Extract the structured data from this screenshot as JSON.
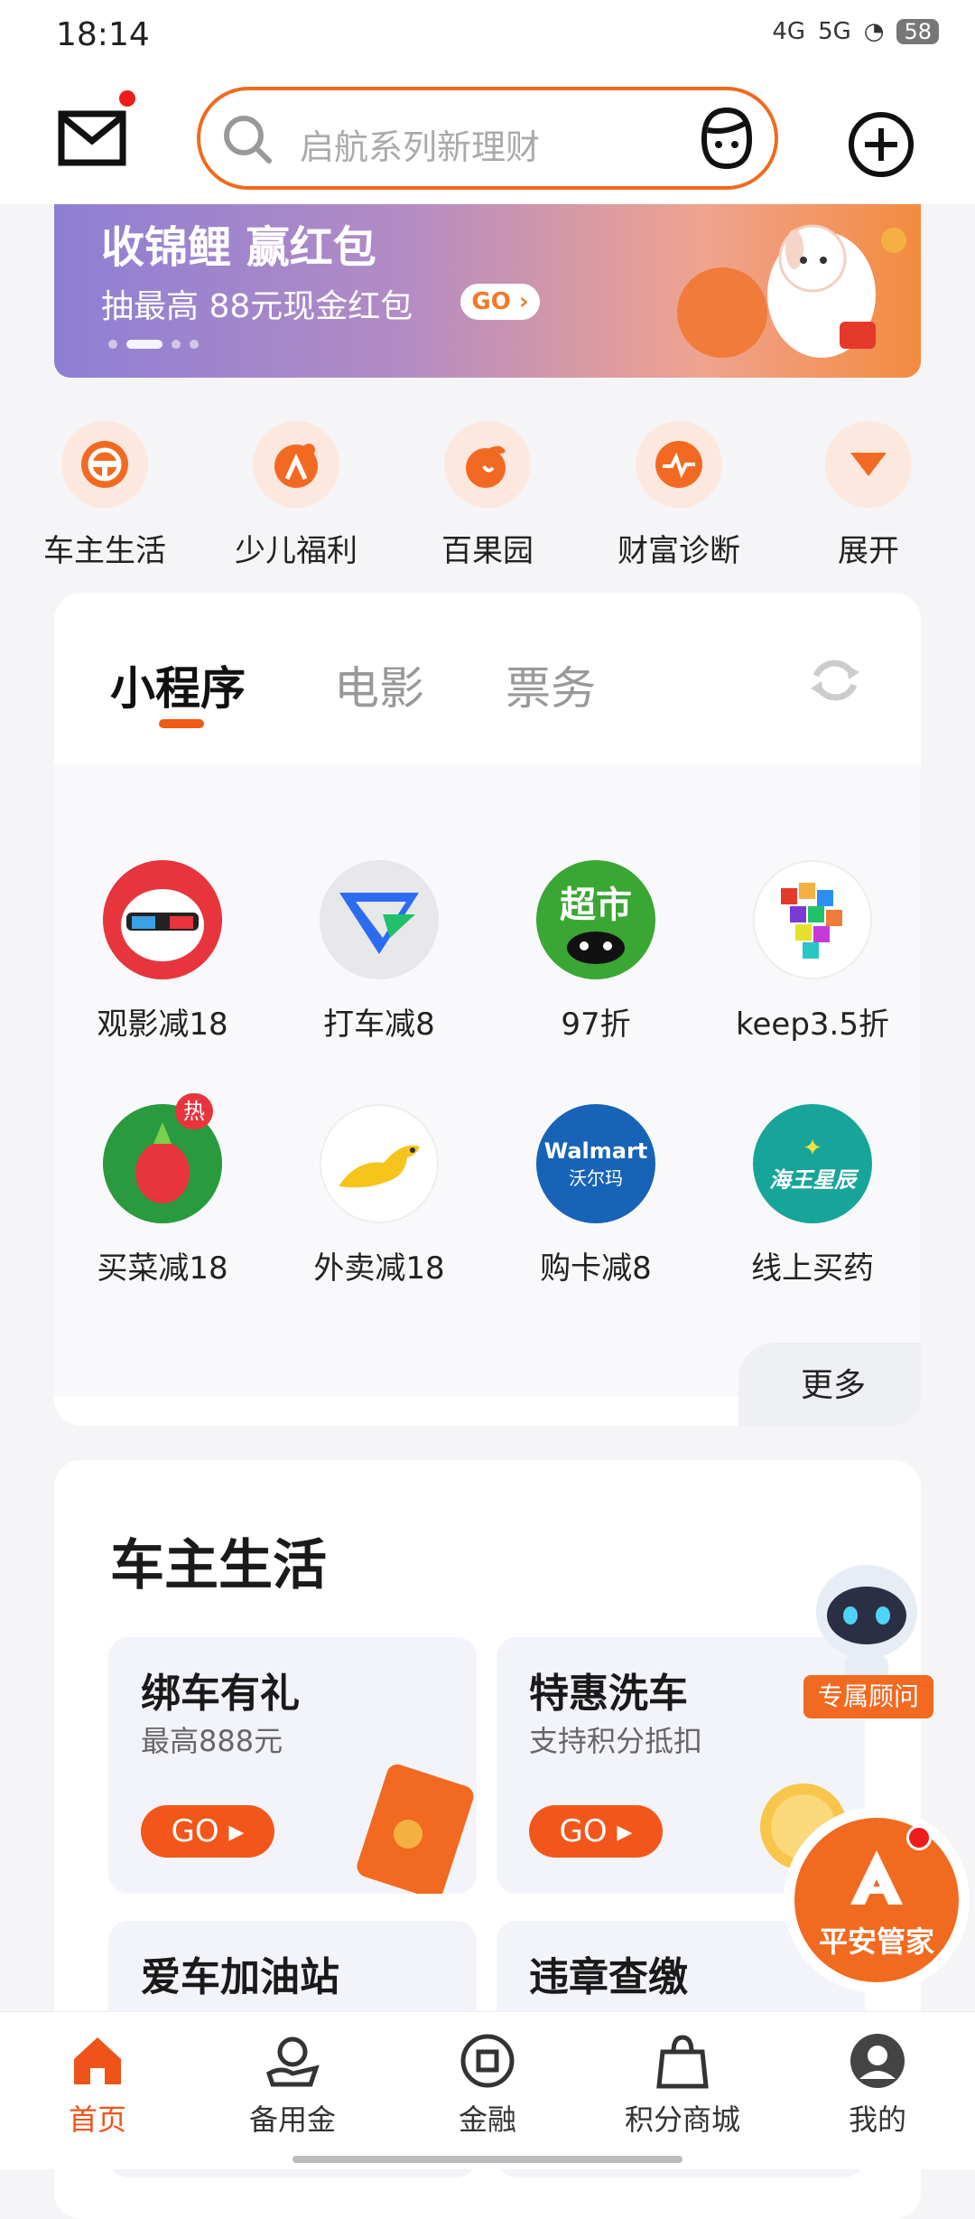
{
  "status_bar": {
    "time": "18:14",
    "network_1": "4G",
    "network_2": "5G",
    "battery": "58"
  },
  "header": {
    "search_placeholder": "启航系列新理财"
  },
  "banner": {
    "title": "收锦鲤 赢红包",
    "subtitle": "抽最高 88元现金红包",
    "go_label": "GO"
  },
  "quick_nav": [
    {
      "label": "车主生活",
      "icon": "steering-wheel-icon"
    },
    {
      "label": "少儿福利",
      "icon": "child-icon"
    },
    {
      "label": "百果园",
      "icon": "fruit-icon"
    },
    {
      "label": "财富诊断",
      "icon": "wealth-diagnosis-icon"
    },
    {
      "label": "展开",
      "icon": "expand-arrow-icon"
    }
  ],
  "mini_programs": {
    "tabs": [
      {
        "label": "小程序"
      },
      {
        "label": "电影"
      },
      {
        "label": "票务"
      }
    ],
    "items": [
      {
        "label": "观影减18",
        "icon": "movie-glasses-icon"
      },
      {
        "label": "打车减8",
        "icon": "taxi-logo-icon"
      },
      {
        "label": "97折",
        "icon": "supermarket-icon",
        "badge_text": "超市"
      },
      {
        "label": "keep3.5折",
        "icon": "keep-cubes-icon"
      },
      {
        "label": "买菜减18",
        "icon": "radish-icon",
        "badge": "热"
      },
      {
        "label": "外卖减18",
        "icon": "kangaroo-icon"
      },
      {
        "label": "购卡减8",
        "icon": "walmart-icon",
        "logo_text": "Walmart",
        "logo_sub": "沃尔玛"
      },
      {
        "label": "线上买药",
        "icon": "pharmacy-icon",
        "logo_text": "海王星辰"
      }
    ],
    "more_label": "更多"
  },
  "car_life": {
    "title": "车主生活",
    "tiles": [
      {
        "title": "绑车有礼",
        "subtitle": "最高888元",
        "go": "GO"
      },
      {
        "title": "特惠洗车",
        "subtitle": "支持积分抵扣",
        "go": "GO"
      },
      {
        "title": "爱车加油站",
        "subtitle": ""
      },
      {
        "title": "违章查缴",
        "subtitle": ""
      }
    ]
  },
  "floating": {
    "advisor_label": "专属顾问",
    "butler_label": "平安管家"
  },
  "bottom_nav": [
    {
      "label": "首页",
      "active": true
    },
    {
      "label": "备用金"
    },
    {
      "label": "金融"
    },
    {
      "label": "积分商城"
    },
    {
      "label": "我的"
    }
  ],
  "colors": {
    "accent": "#f05a14",
    "banner_start": "#8e7fd4",
    "banner_end": "#f38b3f"
  }
}
